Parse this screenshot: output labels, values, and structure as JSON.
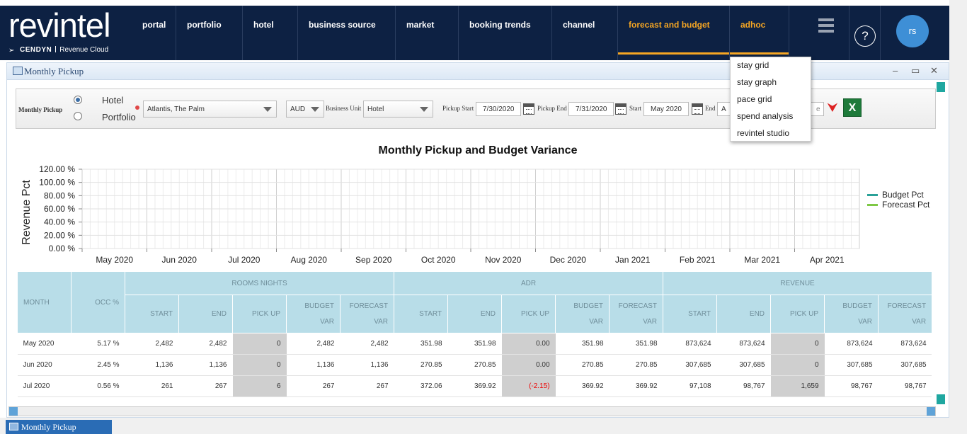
{
  "brand": {
    "wordmark": "revintel",
    "company": "CENDYN",
    "product": "Revenue Cloud"
  },
  "nav": {
    "items": [
      "portal",
      "portfolio",
      "hotel",
      "business source",
      "market",
      "booking trends",
      "channel",
      "forecast and budget",
      "adhoc"
    ],
    "active": "forecast and budget",
    "help_label": "?",
    "user_initials": "rs"
  },
  "adhoc_menu": {
    "items": [
      "stay grid",
      "stay graph",
      "pace grid",
      "spend analysis",
      "revintel studio"
    ]
  },
  "window": {
    "title": "Monthly Pickup",
    "controls": [
      "–",
      "▭",
      "✕"
    ]
  },
  "filters": {
    "report_label": "Monthly Pickup",
    "scope_options": [
      "Hotel",
      "Portfolio"
    ],
    "scope_selected": "Hotel",
    "property": "Atlantis, The Palm",
    "currency": "AUD",
    "business_unit_label": "Business Unit",
    "business_unit": "Hotel",
    "pickup_start_label": "Pickup Start",
    "pickup_start": "7/30/2020",
    "pickup_end_label": "Pickup End",
    "pickup_end": "7/31/2020",
    "start_label": "Start",
    "start": "May 2020",
    "end_label": "End",
    "end_partial": "A",
    "hidden_field_partial": "e"
  },
  "chart_data": {
    "type": "line",
    "title": "Monthly Pickup and Budget Variance",
    "ylabel": "Revenue Pct",
    "xlabel": "",
    "categories": [
      "May 2020",
      "Jun 2020",
      "Jul 2020",
      "Aug 2020",
      "Sep 2020",
      "Oct 2020",
      "Nov 2020",
      "Dec 2020",
      "Jan 2021",
      "Feb 2021",
      "Mar 2021",
      "Apr 2021"
    ],
    "y_ticks": [
      "0.00 %",
      "20.00 %",
      "40.00 %",
      "60.00 %",
      "80.00 %",
      "100.00 %",
      "120.00 %"
    ],
    "ylim": [
      0,
      120
    ],
    "grid": true,
    "legend_position": "right",
    "series": [
      {
        "name": "Budget Pct",
        "color": "#2aa198",
        "values": []
      },
      {
        "name": "Forecast Pct",
        "color": "#7ec845",
        "values": []
      }
    ]
  },
  "table": {
    "groups": [
      "ROOMS NIGHTS",
      "ADR",
      "REVENUE"
    ],
    "month_header": "MONTH",
    "occ_header": "OCC %",
    "sub_headers": [
      "START",
      "END",
      "PICK UP",
      "BUDGET VAR",
      "FORECAST VAR"
    ],
    "rows": [
      {
        "month": "May 2020",
        "occ": "5.17 %",
        "cells": [
          "2,482",
          "2,482",
          "0",
          "2,482",
          "2,482",
          "351.98",
          "351.98",
          "0.00",
          "351.98",
          "351.98",
          "873,624",
          "873,624",
          "0",
          "873,624",
          "873,624"
        ]
      },
      {
        "month": "Jun 2020",
        "occ": "2.45 %",
        "cells": [
          "1,136",
          "1,136",
          "0",
          "1,136",
          "1,136",
          "270.85",
          "270.85",
          "0.00",
          "270.85",
          "270.85",
          "307,685",
          "307,685",
          "0",
          "307,685",
          "307,685"
        ]
      },
      {
        "month": "Jul 2020",
        "occ": "0.56 %",
        "cells": [
          "261",
          "267",
          "6",
          "267",
          "267",
          "372.06",
          "369.92",
          "(-2.15)",
          "369.92",
          "369.92",
          "97,108",
          "98,767",
          "1,659",
          "98,767",
          "98,767"
        ]
      }
    ]
  },
  "taskbar": {
    "tab": "Monthly Pickup"
  }
}
